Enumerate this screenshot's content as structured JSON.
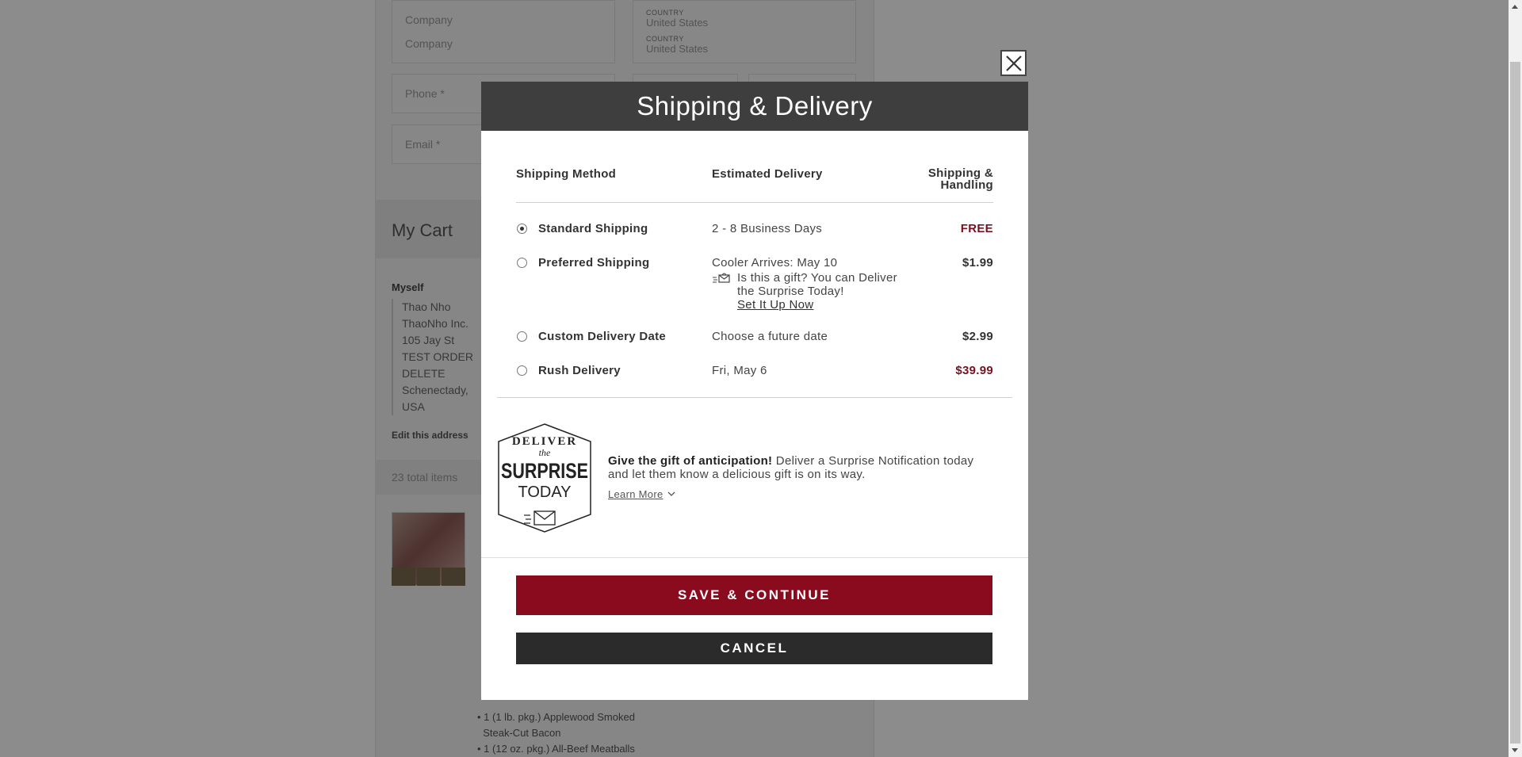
{
  "background": {
    "fields": {
      "company_placeholder": "Company",
      "country_label": "COUNTRY",
      "country_value": "United States",
      "phone_placeholder": "Phone *",
      "email_placeholder": "Email *"
    },
    "cart_title": "My Cart",
    "address": {
      "owner": "Myself",
      "lines": [
        "Thao Nho",
        "ThaoNho Inc.",
        "105 Jay St",
        "TEST ORDER",
        "DELETE",
        "Schenectady,",
        "USA"
      ]
    },
    "edit_address_label": "Edit this address",
    "total_items_label": "23 total items",
    "product_list": [
      "1 (1 lb. pkg.) Applewood Smoked",
      "Steak-Cut Bacon",
      "1 (12 oz. pkg.) All-Beef Meatballs"
    ]
  },
  "modal": {
    "title": "Shipping & Delivery",
    "columns": {
      "method": "Shipping Method",
      "estimated": "Estimated Delivery",
      "handling": "Shipping & Handling"
    },
    "options": [
      {
        "name": "Standard Shipping",
        "estimate": "2 - 8 Business Days",
        "price": "FREE",
        "selected": true
      },
      {
        "name": "Preferred Shipping",
        "estimate": "Cooler Arrives: May 10",
        "price": "$1.99",
        "selected": false,
        "gift_note": "Is this a gift? You can Deliver the Surprise Today!",
        "gift_link": "Set It Up Now"
      },
      {
        "name": "Custom Delivery Date",
        "estimate": "Choose a future date",
        "price": "$2.99",
        "selected": false
      },
      {
        "name": "Rush Delivery",
        "estimate": "Fri, May 6",
        "price": "$39.99",
        "selected": false
      }
    ],
    "promo": {
      "badge_lines": [
        "DELIVER",
        "the",
        "SURPRISE",
        "TODAY"
      ],
      "headline": "Give the gift of anticipation!",
      "body": " Deliver a Surprise Notification today and let them know a delicious gift is on its way.",
      "learn_more": "Learn More"
    },
    "save_label": "SAVE & CONTINUE",
    "cancel_label": "CANCEL"
  },
  "colors": {
    "accent_red": "#8a0a1e",
    "price_red": "#7a1020",
    "header_dark": "#3e3e3e"
  }
}
